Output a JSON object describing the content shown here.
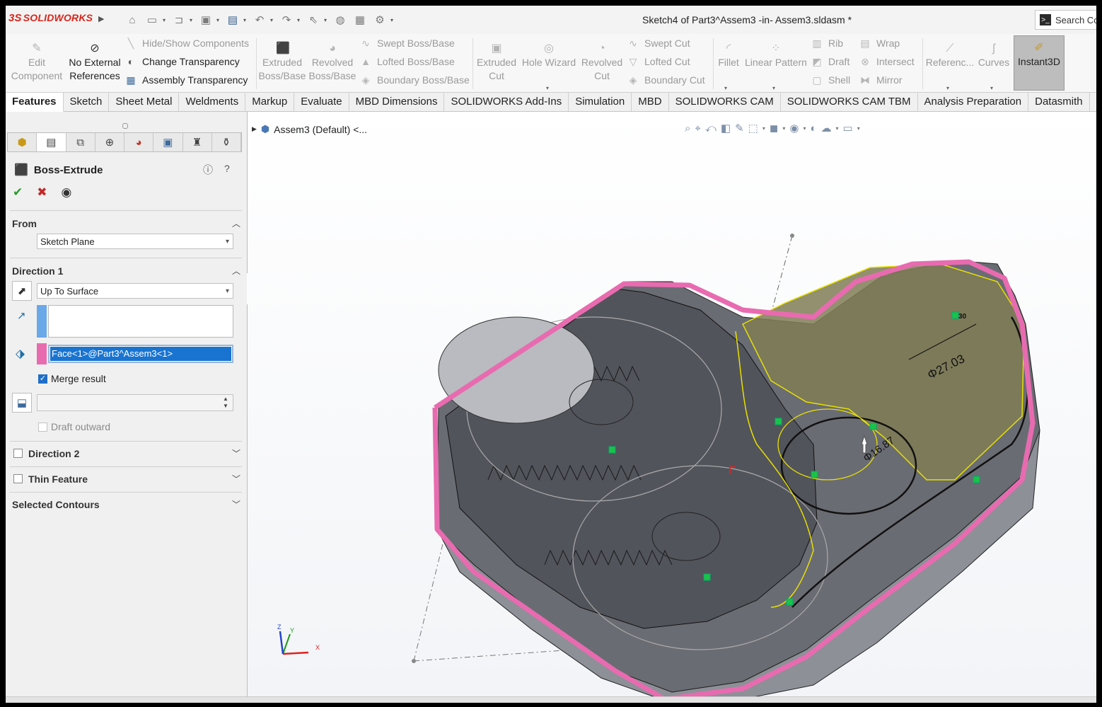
{
  "app": {
    "brand": "SOLIDWORKS",
    "brand_prefix": "3S"
  },
  "window": {
    "title": "Sketch4 of Part3^Assem3 -in- Assem3.sldasm *"
  },
  "search": {
    "label": "Search Co"
  },
  "quick_access": [
    "home-icon",
    "new-icon",
    "open-icon",
    "save-icon",
    "print-icon",
    "undo-icon",
    "redo-icon",
    "select-icon",
    "rebuild-icon",
    "file-properties-icon",
    "options-icon"
  ],
  "ribbon": {
    "edit_component": [
      "Edit",
      "Component"
    ],
    "no_external": [
      "No External",
      "References"
    ],
    "hide_show": "Hide/Show Components",
    "change_transparency": "Change Transparency",
    "assembly_transparency": "Assembly Transparency",
    "extruded_boss": [
      "Extruded",
      "Boss/Base"
    ],
    "revolved_boss": [
      "Revolved",
      "Boss/Base"
    ],
    "swept_boss": "Swept Boss/Base",
    "lofted_boss": "Lofted Boss/Base",
    "boundary_boss": "Boundary Boss/Base",
    "extruded_cut": [
      "Extruded",
      "Cut"
    ],
    "hole_wizard": "Hole Wizard",
    "revolved_cut": [
      "Revolved",
      "Cut"
    ],
    "swept_cut": "Swept Cut",
    "lofted_cut": "Lofted Cut",
    "boundary_cut": "Boundary Cut",
    "fillet": "Fillet",
    "linear_pattern": "Linear Pattern",
    "rib": "Rib",
    "draft": "Draft",
    "shell": "Shell",
    "wrap": "Wrap",
    "intersect": "Intersect",
    "mirror": "Mirror",
    "reference": "Referenc...",
    "curves": "Curves",
    "instant3d": "Instant3D"
  },
  "tabs": [
    {
      "label": "Features",
      "active": true
    },
    {
      "label": "Sketch"
    },
    {
      "label": "Sheet Metal"
    },
    {
      "label": "Weldments"
    },
    {
      "label": "Markup"
    },
    {
      "label": "Evaluate"
    },
    {
      "label": "MBD Dimensions"
    },
    {
      "label": "SOLIDWORKS Add-Ins"
    },
    {
      "label": "Simulation"
    },
    {
      "label": "MBD"
    },
    {
      "label": "SOLIDWORKS CAM"
    },
    {
      "label": "SOLIDWORKS CAM TBM"
    },
    {
      "label": "Analysis Preparation"
    },
    {
      "label": "Datasmith"
    }
  ],
  "property_manager": {
    "title": "Boss-Extrude",
    "from": {
      "label": "From",
      "value": "Sketch Plane"
    },
    "direction1": {
      "label": "Direction 1",
      "end_condition": "Up To Surface",
      "face": "Face<1>@Part3^Assem3<1>",
      "merge_result": {
        "label": "Merge result",
        "checked": true
      },
      "draft_outward": {
        "label": "Draft outward",
        "checked": false
      }
    },
    "direction2": {
      "label": "Direction 2",
      "checked": false
    },
    "thin_feature": {
      "label": "Thin Feature",
      "checked": false
    },
    "selected_contours": {
      "label": "Selected Contours"
    }
  },
  "viewport": {
    "tree_root": "Assem3 (Default) <...",
    "dimensions": [
      "Φ27.03",
      "Φ16.87",
      "30"
    ],
    "triad": {
      "x": "X",
      "y": "Y",
      "z": "Z"
    }
  },
  "colors": {
    "accent": "#1874d0",
    "selection_pink": "#e86bb0",
    "preview_yellow": "#e8e000",
    "body_gray": "#5f6168"
  }
}
